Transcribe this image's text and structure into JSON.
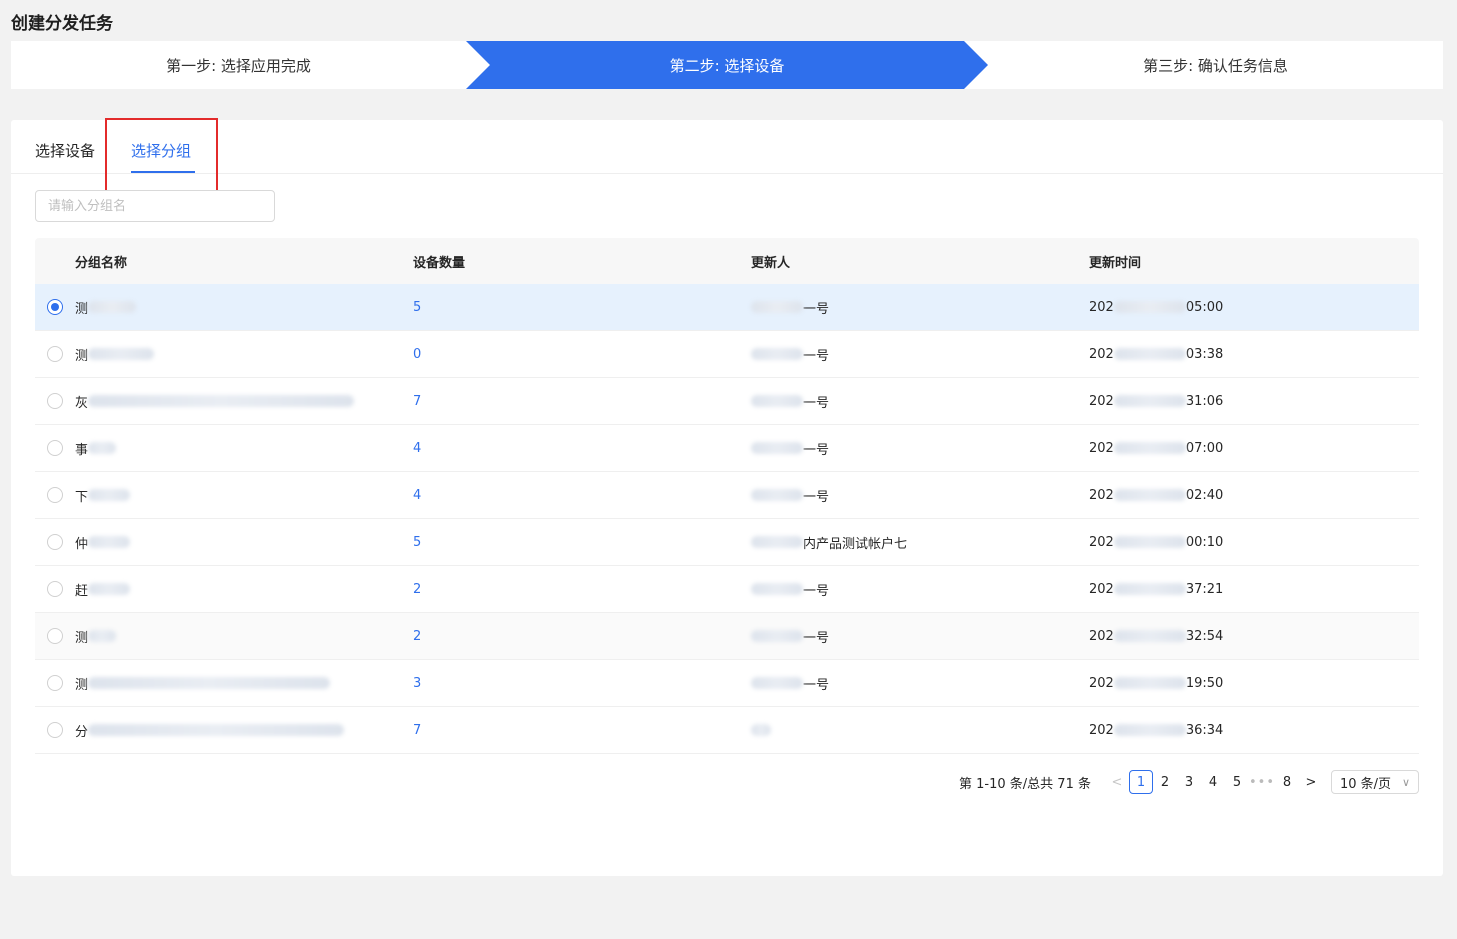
{
  "page": {
    "title": "创建分发任务"
  },
  "steps": [
    {
      "label": "第一步: 选择应用完成"
    },
    {
      "label": "第二步: 选择设备"
    },
    {
      "label": "第三步: 确认任务信息"
    }
  ],
  "tabs": {
    "devices": "选择设备",
    "groups": "选择分组"
  },
  "search": {
    "placeholder": "请输入分组名"
  },
  "table": {
    "headers": {
      "name": "分组名称",
      "count": "设备数量",
      "updater": "更新人",
      "time": "更新时间"
    },
    "rows": [
      {
        "name": "测",
        "count": "5",
        "updater": "一号",
        "time_prefix": "202",
        "time_suffix": "05:00"
      },
      {
        "name": "测",
        "count": "0",
        "updater": "一号",
        "time_prefix": "202",
        "time_suffix": "03:38"
      },
      {
        "name": "灰",
        "count": "7",
        "updater": "一号",
        "time_prefix": "202",
        "time_suffix": "31:06"
      },
      {
        "name": "事",
        "count": "4",
        "updater": "一号",
        "time_prefix": "202",
        "time_suffix": "07:00"
      },
      {
        "name": "下",
        "count": "4",
        "updater": "一号",
        "time_prefix": "202",
        "time_suffix": "02:40"
      },
      {
        "name": "仲",
        "count": "5",
        "updater": "内产品测试帐户七",
        "time_prefix": "202",
        "time_suffix": "00:10"
      },
      {
        "name": "赶",
        "count": "2",
        "updater": "一号",
        "time_prefix": "202",
        "time_suffix": "37:21"
      },
      {
        "name": "测",
        "count": "2",
        "updater": "一号",
        "time_prefix": "202",
        "time_suffix": "32:54"
      },
      {
        "name": "测",
        "count": "3",
        "updater": "一号",
        "time_prefix": "202",
        "time_suffix": "19:50"
      },
      {
        "name": "分",
        "count": "7",
        "updater": "",
        "time_prefix": "202",
        "time_suffix": "36:34"
      }
    ]
  },
  "pagination": {
    "total_text": "第 1-10 条/总共 71 条",
    "prev": "<",
    "next": ">",
    "pages": [
      "1",
      "2",
      "3",
      "4",
      "5"
    ],
    "ellipsis": "•••",
    "last": "8",
    "page_size": "10 条/页",
    "current": "1"
  },
  "colors": {
    "accent": "#2f6fec",
    "highlight": "#e32b2b"
  }
}
